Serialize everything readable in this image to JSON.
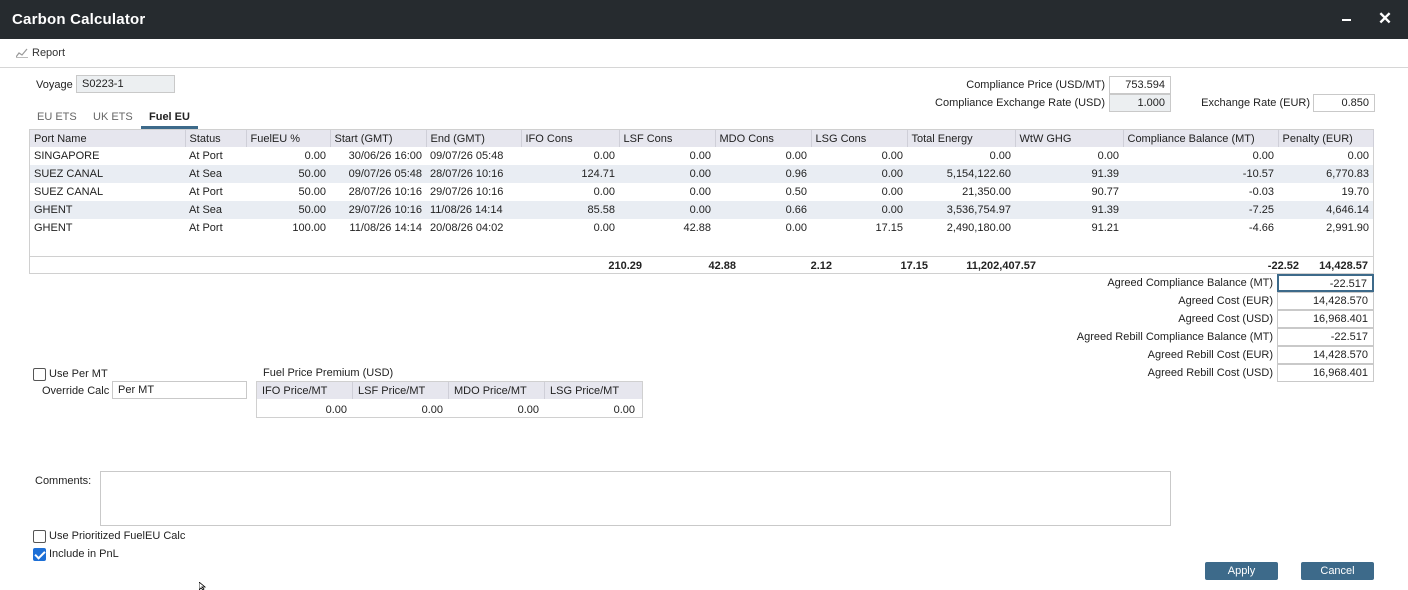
{
  "window": {
    "title": "Carbon Calculator"
  },
  "toolbar": {
    "report_label": "Report"
  },
  "voyage": {
    "label": "Voyage",
    "value": "S0223-1"
  },
  "rates": {
    "compliance_price_label": "Compliance Price (USD/MT)",
    "compliance_price_value": "753.594",
    "compliance_exchange_label": "Compliance Exchange Rate (USD)",
    "compliance_exchange_value": "1.000",
    "exchange_rate_label": "Exchange Rate (EUR)",
    "exchange_rate_value": "0.850"
  },
  "tabs": [
    "EU ETS",
    "UK ETS",
    "Fuel EU"
  ],
  "active_tab": "Fuel EU",
  "grid": {
    "columns": [
      "Port Name",
      "Status",
      "FuelEU %",
      "Start (GMT)",
      "End (GMT)",
      "IFO Cons",
      "LSF Cons",
      "MDO Cons",
      "LSG Cons",
      "Total Energy",
      "WtW GHG",
      "Compliance Balance (MT)",
      "Penalty (EUR)"
    ],
    "rows": [
      [
        "SINGAPORE",
        "At Port",
        "0.00",
        "30/06/26 16:00",
        "09/07/26 05:48",
        "0.00",
        "0.00",
        "0.00",
        "0.00",
        "0.00",
        "0.00",
        "0.00",
        "0.00"
      ],
      [
        "SUEZ CANAL",
        "At Sea",
        "50.00",
        "09/07/26 05:48",
        "28/07/26 10:16",
        "124.71",
        "0.00",
        "0.96",
        "0.00",
        "5,154,122.60",
        "91.39",
        "-10.57",
        "6,770.83"
      ],
      [
        "SUEZ CANAL",
        "At Port",
        "50.00",
        "28/07/26 10:16",
        "29/07/26 10:16",
        "0.00",
        "0.00",
        "0.50",
        "0.00",
        "21,350.00",
        "90.77",
        "-0.03",
        "19.70"
      ],
      [
        "GHENT",
        "At Sea",
        "50.00",
        "29/07/26 10:16",
        "11/08/26 14:14",
        "85.58",
        "0.00",
        "0.66",
        "0.00",
        "3,536,754.97",
        "91.39",
        "-7.25",
        "4,646.14"
      ],
      [
        "GHENT",
        "At Port",
        "100.00",
        "11/08/26 14:14",
        "20/08/26 04:02",
        "0.00",
        "42.88",
        "0.00",
        "17.15",
        "2,490,180.00",
        "91.21",
        "-4.66",
        "2,991.90"
      ]
    ],
    "totals": {
      "ifo": "210.29",
      "lsf": "42.88",
      "mdo": "2.12",
      "lsg": "17.15",
      "total_energy": "11,202,407.57",
      "compliance_balance": "-22.52",
      "penalty": "14,428.57"
    }
  },
  "agreed": {
    "compliance_balance_label": "Agreed Compliance Balance (MT)",
    "compliance_balance_value": "-22.517",
    "cost_eur_label": "Agreed Cost (EUR)",
    "cost_eur_value": "14,428.570",
    "cost_usd_label": "Agreed Cost (USD)",
    "cost_usd_value": "16,968.401",
    "rebill_balance_label": "Agreed Rebill Compliance Balance (MT)",
    "rebill_balance_value": "-22.517",
    "rebill_eur_label": "Agreed Rebill Cost (EUR)",
    "rebill_eur_value": "14,428.570",
    "rebill_usd_label": "Agreed Rebill Cost (USD)",
    "rebill_usd_value": "16,968.401"
  },
  "per_mt": {
    "use_per_mt_label": "Use Per MT",
    "use_per_mt_checked": false,
    "override_label": "Override Calc",
    "override_value": "Per MT"
  },
  "premium": {
    "title": "Fuel Price Premium (USD)",
    "columns": [
      "IFO Price/MT",
      "LSF Price/MT",
      "MDO Price/MT",
      "LSG Price/MT"
    ],
    "values": [
      "0.00",
      "0.00",
      "0.00",
      "0.00"
    ]
  },
  "comments": {
    "label": "Comments:",
    "value": ""
  },
  "options": {
    "prioritized_label": "Use Prioritized FuelEU Calc",
    "prioritized_checked": false,
    "pnl_label": "Include in PnL",
    "pnl_checked": true
  },
  "buttons": {
    "apply": "Apply",
    "cancel": "Cancel"
  },
  "colors": {
    "titlebar": "#262b2f",
    "accent": "#3d6a8a",
    "checkbox": "#1d6fd6"
  }
}
